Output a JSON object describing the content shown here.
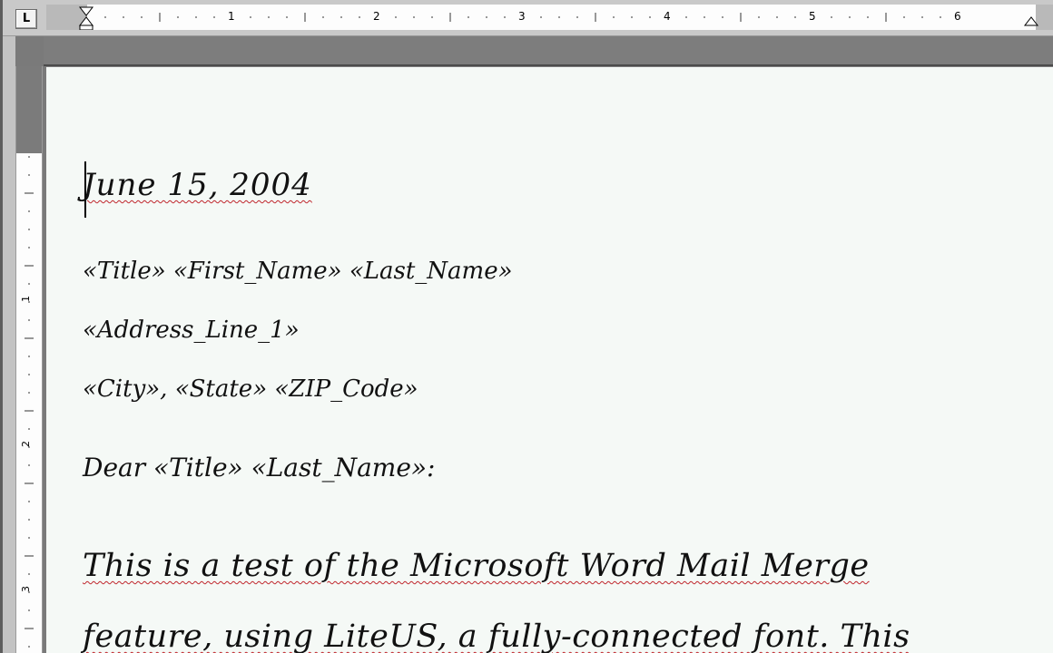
{
  "ruler": {
    "tab_selector": "L",
    "numbers": [
      "1",
      "2",
      "3",
      "4",
      "5",
      "6"
    ],
    "vertical_numbers": [
      "1",
      "2",
      "3"
    ]
  },
  "document": {
    "date": "June 15, 2004",
    "address": {
      "line1": "«Title» «First_Name» «Last_Name»",
      "line2": "«Address_Line_1»",
      "line3": "«City», «State» «ZIP_Code»"
    },
    "salutation": "Dear «Title» «Last_Name»:",
    "body": {
      "line1": "This is a test of the Microsoft Word Mail Merge",
      "line2": "feature, using LiteUS, a fully-connected font. This"
    }
  },
  "colors": {
    "page": "#f5f9f6",
    "spelling_error": "#c0262c",
    "ruler_active": "#fdfdfd",
    "chrome_gray": "#7d7d7d"
  }
}
